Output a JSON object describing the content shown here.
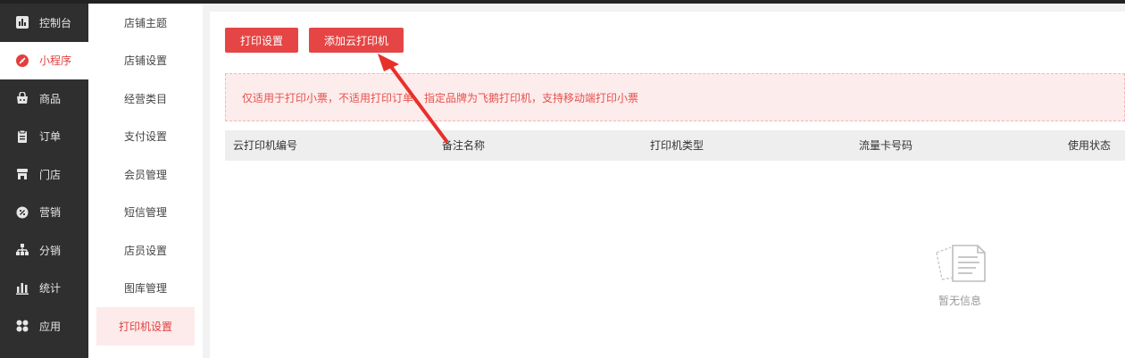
{
  "sidebar": {
    "items": [
      {
        "label": "控制台",
        "icon": "dashboard-icon"
      },
      {
        "label": "小程序",
        "icon": "mini-program-icon"
      },
      {
        "label": "商品",
        "icon": "goods-icon"
      },
      {
        "label": "订单",
        "icon": "order-icon"
      },
      {
        "label": "门店",
        "icon": "store-icon"
      },
      {
        "label": "营销",
        "icon": "marketing-icon"
      },
      {
        "label": "分销",
        "icon": "distribution-icon"
      },
      {
        "label": "统计",
        "icon": "statistics-icon"
      },
      {
        "label": "应用",
        "icon": "apps-icon"
      }
    ],
    "active_index": 1
  },
  "subnav": {
    "items": [
      {
        "label": "店铺主题"
      },
      {
        "label": "店铺设置"
      },
      {
        "label": "经营类目"
      },
      {
        "label": "支付设置"
      },
      {
        "label": "会员管理"
      },
      {
        "label": "短信管理"
      },
      {
        "label": "店员设置"
      },
      {
        "label": "图库管理"
      },
      {
        "label": "打印机设置"
      }
    ],
    "active_index": 8
  },
  "toolbar": {
    "print_settings_label": "打印设置",
    "add_cloud_printer_label": "添加云打印机"
  },
  "notice": {
    "text": "仅适用于打印小票，不适用打印订单，指定品牌为飞鹅打印机，支持移动端打印小票"
  },
  "table": {
    "columns": [
      "云打印机编号",
      "备注名称",
      "打印机类型",
      "流量卡号码",
      "使用状态"
    ],
    "rows": []
  },
  "empty_state": {
    "label": "暂无信息",
    "icon": "empty-document-icon"
  },
  "colors": {
    "accent": "#e64545",
    "sidebar_bg": "#2f2f2f",
    "notice_bg": "#fdecec"
  }
}
